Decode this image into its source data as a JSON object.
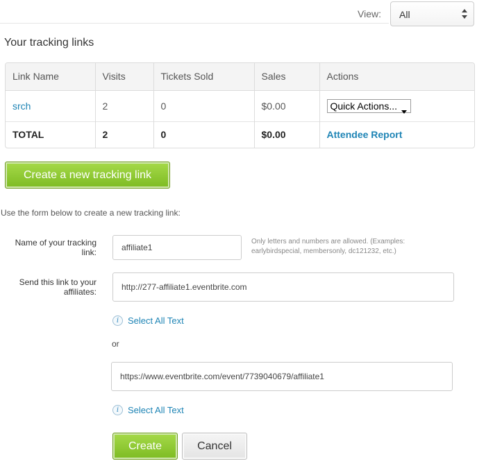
{
  "view": {
    "label": "View:",
    "selected": "All"
  },
  "section_title": "Your tracking links",
  "table": {
    "headers": [
      "Link Name",
      "Visits",
      "Tickets Sold",
      "Sales",
      "Actions"
    ],
    "rows": [
      {
        "name": "srch",
        "visits": "2",
        "tickets": "0",
        "sales": "$0.00",
        "action": "Quick Actions..."
      }
    ],
    "total": {
      "name": "TOTAL",
      "visits": "2",
      "tickets": "0",
      "sales": "$0.00",
      "action": "Attendee Report"
    }
  },
  "create_link_button": "Create a new tracking link",
  "intro_text": "Use the form below to create a new tracking link:",
  "form": {
    "name_label": "Name of your tracking link:",
    "name_value": "affiliate1",
    "name_hint": "Only letters and numbers are allowed. (Examples: earlybirdspecial, membersonly, dc121232, etc.)",
    "send_label": "Send this link to your affiliates:",
    "link_short": "http://277-affiliate1.eventbrite.com",
    "select_all_1": "Select All Text",
    "or_text": "or",
    "link_long": "https://www.eventbrite.com/event/7739040679/affiliate1",
    "select_all_2": "Select All Text",
    "info_glyph": "i",
    "create_button": "Create",
    "cancel_button": "Cancel"
  },
  "colors": {
    "accent_green": "#8cc63f",
    "link_blue": "#1e84b5"
  }
}
